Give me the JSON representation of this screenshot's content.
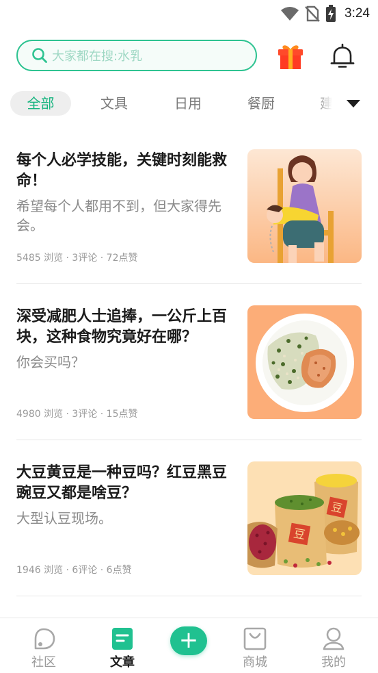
{
  "status_bar": {
    "time": "3:24"
  },
  "search": {
    "placeholder": "大家都在搜:水乳"
  },
  "categories": [
    {
      "label": "全部",
      "active": true
    },
    {
      "label": "文具",
      "active": false
    },
    {
      "label": "日用",
      "active": false
    },
    {
      "label": "餐厨",
      "active": false
    },
    {
      "label": "建",
      "active": false
    }
  ],
  "articles": [
    {
      "title": "每个人必学技能，关键时刻能救命！",
      "subtitle": "希望每个人都用不到，但大家得先会。",
      "meta": "5485 浏览 · 3评论 · 72点赞",
      "thumb_icon": "first-aid-illustration"
    },
    {
      "title": "深受减肥人士追捧，一公斤上百块，这种食物究竟好在哪？",
      "subtitle": "你会买吗？",
      "meta": "4980 浏览 · 3评论 · 15点赞",
      "thumb_icon": "quinoa-plate-illustration"
    },
    {
      "title": "大豆黄豆是一种豆吗？红豆黑豆豌豆又都是啥豆？",
      "subtitle": "大型认豆现场。",
      "meta": "1946 浏览 · 6评论 · 6点赞",
      "thumb_icon": "bean-sacks-illustration",
      "thumb_text": "豆"
    }
  ],
  "bottom_nav": {
    "community": "社区",
    "articles": "文章",
    "mall": "商城",
    "mine": "我的",
    "add_symbol": "+"
  },
  "colors": {
    "accent": "#20c190",
    "active_tab_text": "#17b47f",
    "search_border": "#2ec391"
  }
}
